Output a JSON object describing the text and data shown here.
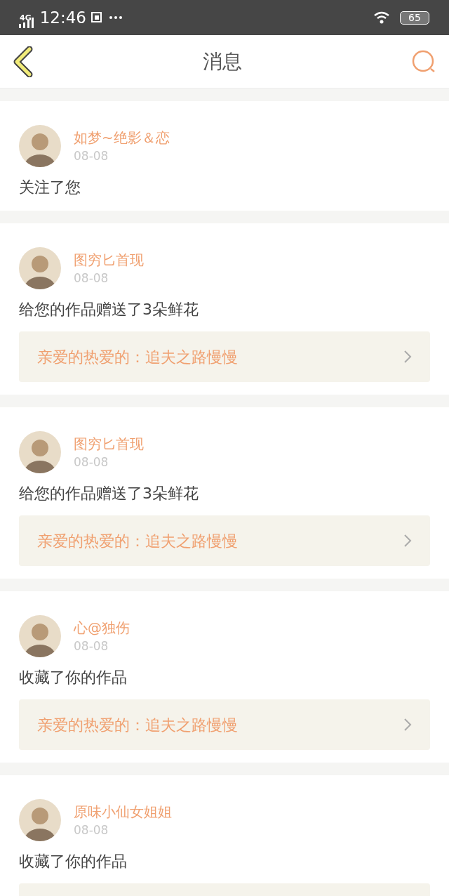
{
  "status_bar": {
    "network": "4G",
    "time": "12:46",
    "battery": "65"
  },
  "header": {
    "title": "消息"
  },
  "messages": [
    {
      "name": "如梦~绝影＆恋",
      "date": "08-08",
      "text": "关注了您",
      "work_box": false
    },
    {
      "name": "图穷匕首现",
      "date": "08-08",
      "text": "给您的作品赠送了3朵鲜花",
      "work_box": true,
      "work": "亲爱的热爱的：追夫之路慢慢"
    },
    {
      "name": "图穷匕首现",
      "date": "08-08",
      "text": "给您的作品赠送了3朵鲜花",
      "work_box": true,
      "work": "亲爱的热爱的：追夫之路慢慢"
    },
    {
      "name": "心@独伤",
      "date": "08-08",
      "text": "收藏了你的作品",
      "work_box": true,
      "work": "亲爱的热爱的：追夫之路慢慢"
    },
    {
      "name": "原味小仙女姐姐",
      "date": "08-08",
      "text": "收藏了你的作品",
      "work_box": true
    }
  ]
}
